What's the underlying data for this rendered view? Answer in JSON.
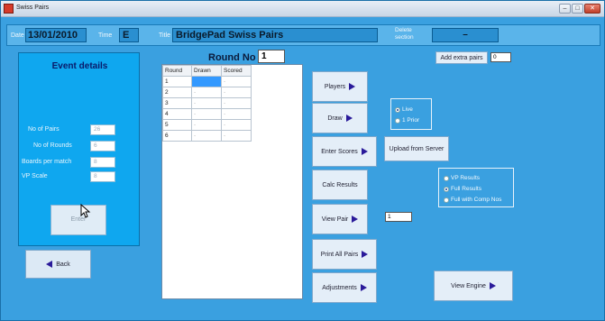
{
  "window": {
    "title": "Swiss Pairs",
    "controls": {
      "minimize": "–",
      "maximize": "□",
      "close": "✕"
    }
  },
  "topbar": {
    "date_label": "Date",
    "date_value": "13/01/2010",
    "time_label": "Time",
    "time_value": "E",
    "title_label": "Title",
    "title_value": "BridgePad Swiss Pairs",
    "delete_label": "Delete section",
    "delete_value": "–"
  },
  "event": {
    "heading": "Event details",
    "fields": [
      {
        "label": "No of Pairs",
        "value": "26"
      },
      {
        "label": "No of Rounds",
        "value": "6"
      },
      {
        "label": "Boards per match",
        "value": "8"
      },
      {
        "label": "VP Scale",
        "value": "8"
      }
    ],
    "enter_label": "Enter"
  },
  "back_label": "Back",
  "round": {
    "label": "Round No",
    "value": "1",
    "headers": [
      "Round",
      "Drawn",
      "Scored"
    ],
    "rows": [
      {
        "round": "1",
        "drawn": "",
        "scored": "-"
      },
      {
        "round": "2",
        "drawn": "-",
        "scored": "-"
      },
      {
        "round": "3",
        "drawn": "-",
        "scored": "-"
      },
      {
        "round": "4",
        "drawn": "-",
        "scored": "-"
      },
      {
        "round": "5",
        "drawn": "-",
        "scored": "-"
      },
      {
        "round": "6",
        "drawn": "-",
        "scored": "-"
      }
    ]
  },
  "buttons": {
    "players": "Players",
    "draw": "Draw",
    "enter_scores": "Enter Scores",
    "upload": "Upload from Server",
    "calc_results": "Calc Results",
    "view_pair": "View Pair",
    "print_all_pairs": "Print All Pairs",
    "adjustments": "Adjustments",
    "view_engine": "View Engine",
    "add_extra_pairs": "Add extra pairs"
  },
  "view_pair_value": "1",
  "extra_pairs_value": "0",
  "draw_options": [
    {
      "label": "Live",
      "selected": true
    },
    {
      "label": "1 Prior",
      "selected": false
    }
  ],
  "result_options": [
    {
      "label": "VP Results",
      "selected": false
    },
    {
      "label": "Full Results",
      "selected": true
    },
    {
      "label": "Full with Comp Nos",
      "selected": false
    }
  ],
  "colors": {
    "window_bg": "#3aa0e0",
    "panel_bg": "#0fa7ef",
    "arrow": "#2a1a9a",
    "selected_cell": "#3399ff"
  }
}
